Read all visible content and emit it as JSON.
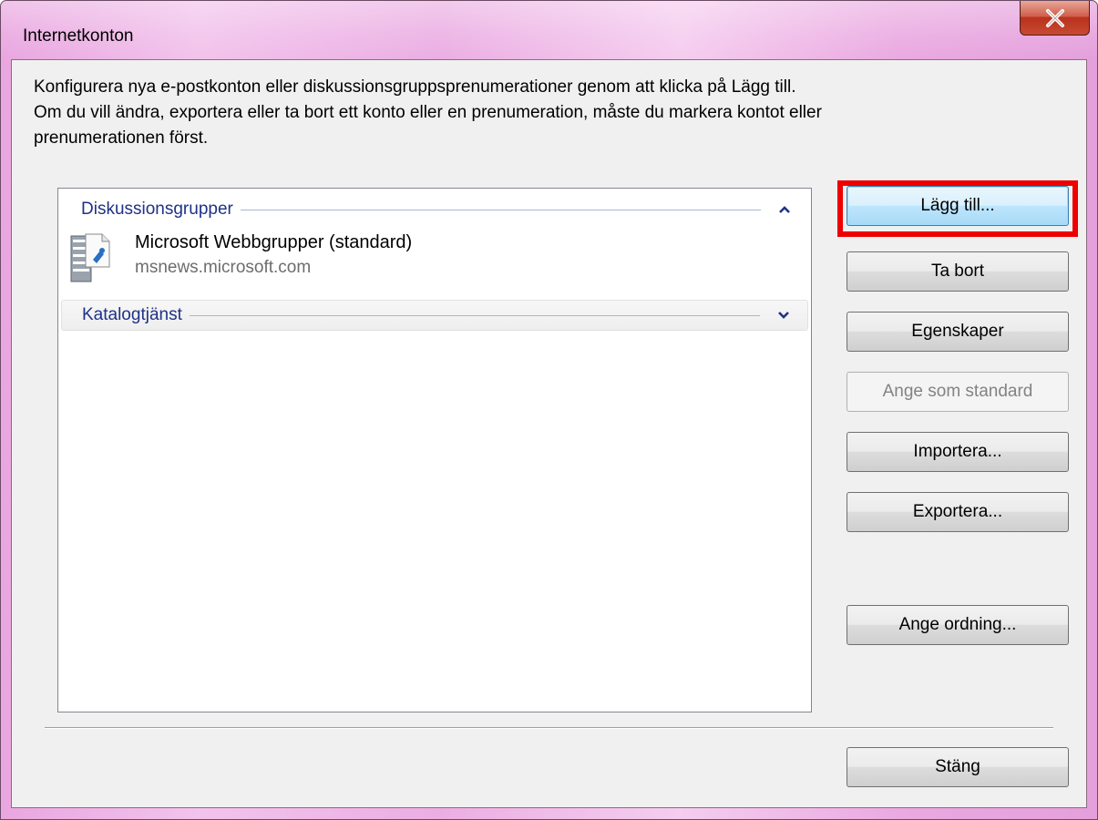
{
  "window": {
    "title": "Internetkonton"
  },
  "description": {
    "line1": "Konfigurera nya e-postkonton eller diskussionsgruppsprenumerationer genom att klicka på Lägg till.",
    "line2": "Om du vill ändra, exportera eller ta bort ett konto eller en prenumeration, måste du markera kontot eller prenumerationen först."
  },
  "accounts": {
    "groups": [
      {
        "label": "Diskussionsgrupper",
        "expanded": true,
        "items": [
          {
            "name": "Microsoft Webbgrupper (standard)",
            "host": "msnews.microsoft.com",
            "icon": "news-server-icon"
          }
        ]
      },
      {
        "label": "Katalogtjänst",
        "expanded": false,
        "items": []
      }
    ]
  },
  "buttons": {
    "add": "Lägg till...",
    "remove": "Ta bort",
    "properties": "Egenskaper",
    "set_default": "Ange som standard",
    "import": "Importera...",
    "export": "Exportera...",
    "set_order": "Ange ordning...",
    "close": "Stäng"
  },
  "colors": {
    "title_gradient": "#ebaee3",
    "group_label": "#1e3287",
    "highlight": "#ee0000",
    "close_button": "#c84a33"
  }
}
